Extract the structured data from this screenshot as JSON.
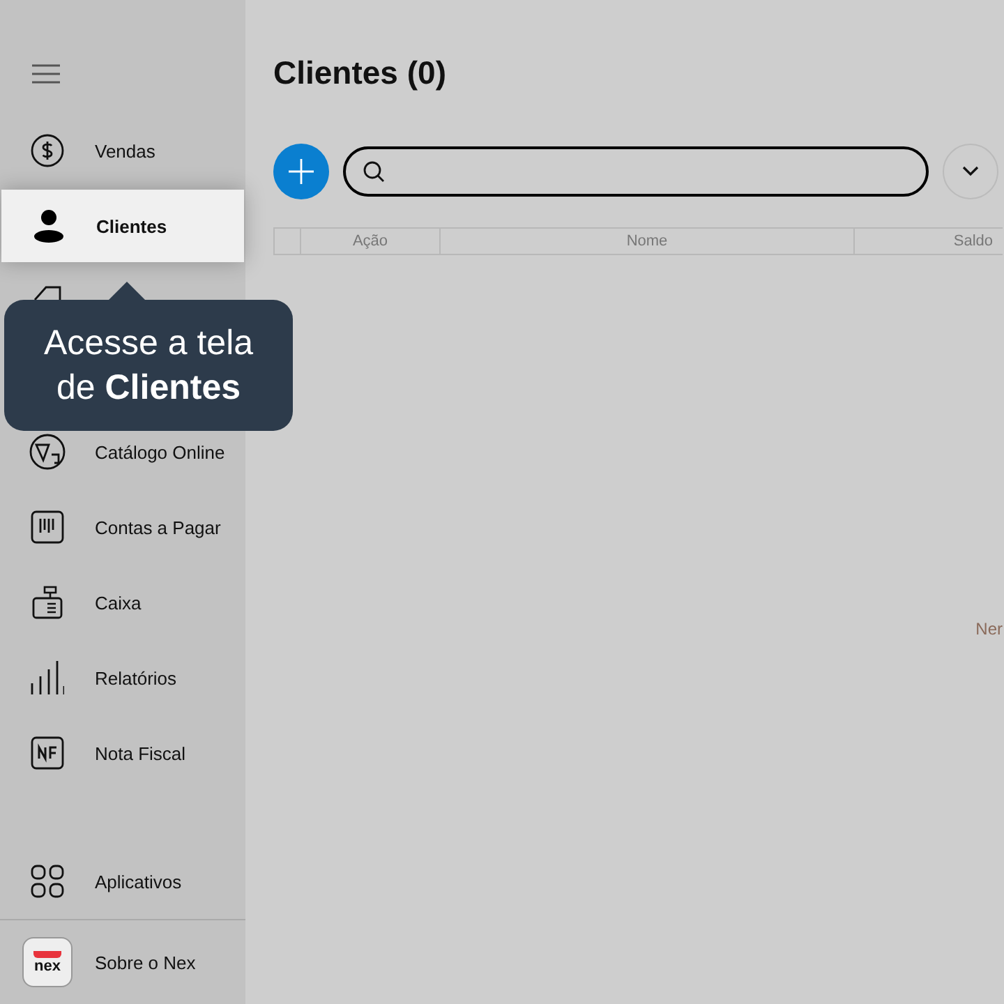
{
  "sidebar": {
    "items": [
      {
        "label": "Vendas",
        "selected": false
      },
      {
        "label": "Clientes",
        "selected": true
      },
      {
        "label": "Catálogo Online",
        "selected": false
      },
      {
        "label": "Contas a Pagar",
        "selected": false
      },
      {
        "label": "Caixa",
        "selected": false
      },
      {
        "label": "Relatórios",
        "selected": false
      },
      {
        "label": "Nota Fiscal",
        "selected": false
      }
    ],
    "apps": {
      "label": "Aplicativos"
    },
    "about": {
      "logo": "nex",
      "label": "Sobre o Nex"
    }
  },
  "tooltip": {
    "text": "Acesse a tela de **Clientes**"
  },
  "page": {
    "title": "Clientes (0)"
  },
  "table": {
    "columns": [
      "Ação",
      "Nome",
      "Saldo"
    ]
  },
  "empty_message": "Ner"
}
